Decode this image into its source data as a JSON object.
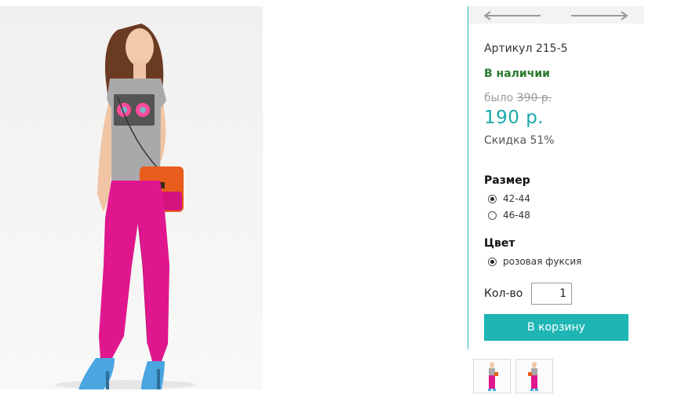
{
  "product": {
    "sku_text": "Артикул 215-5",
    "stock_text": "В наличии",
    "old_price_prefix": "было ",
    "old_price": "390 р.",
    "new_price": "190 р.",
    "discount_text": "Скидка 51%"
  },
  "options": {
    "size_title": "Размер",
    "sizes": [
      {
        "label": "42-44",
        "checked": true
      },
      {
        "label": "46-48",
        "checked": false
      }
    ],
    "color_title": "Цвет",
    "colors": [
      {
        "label": "розовая фуксия",
        "checked": true
      }
    ]
  },
  "quantity": {
    "label": "Кол-во",
    "value": "1"
  },
  "cart": {
    "button_label": "В корзину"
  },
  "navigation": {
    "prev_icon": "arrow-left-icon",
    "next_icon": "arrow-right-icon"
  },
  "colors": {
    "accent": "#1fb5b5",
    "price": "#1aa9a9",
    "in_stock": "#2c7a2c",
    "old_price": "#9a9a9a",
    "pants": "#e0168f",
    "shoes": "#4aa5e0",
    "bag": "#e85d1c"
  }
}
